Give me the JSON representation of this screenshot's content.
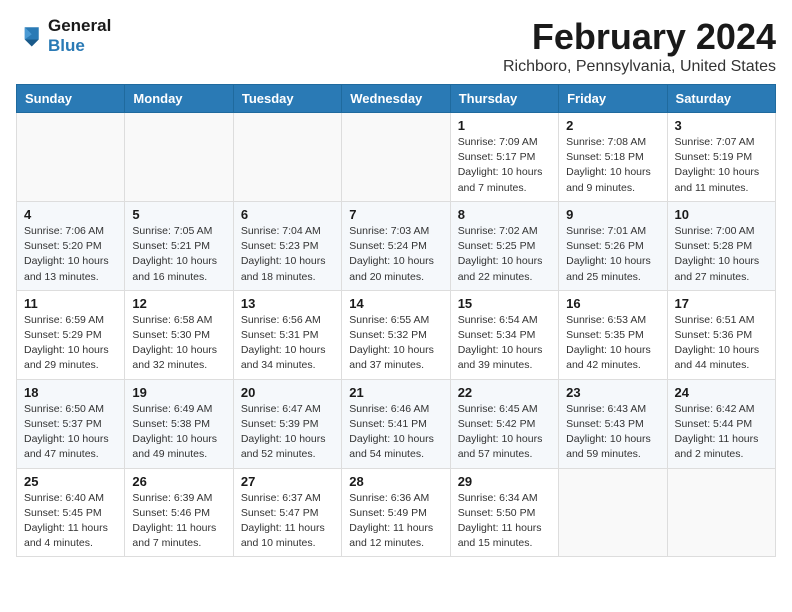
{
  "logo": {
    "line1": "General",
    "line2": "Blue"
  },
  "title": "February 2024",
  "location": "Richboro, Pennsylvania, United States",
  "days_of_week": [
    "Sunday",
    "Monday",
    "Tuesday",
    "Wednesday",
    "Thursday",
    "Friday",
    "Saturday"
  ],
  "weeks": [
    [
      {
        "day": "",
        "info": ""
      },
      {
        "day": "",
        "info": ""
      },
      {
        "day": "",
        "info": ""
      },
      {
        "day": "",
        "info": ""
      },
      {
        "day": "1",
        "info": "Sunrise: 7:09 AM\nSunset: 5:17 PM\nDaylight: 10 hours\nand 7 minutes."
      },
      {
        "day": "2",
        "info": "Sunrise: 7:08 AM\nSunset: 5:18 PM\nDaylight: 10 hours\nand 9 minutes."
      },
      {
        "day": "3",
        "info": "Sunrise: 7:07 AM\nSunset: 5:19 PM\nDaylight: 10 hours\nand 11 minutes."
      }
    ],
    [
      {
        "day": "4",
        "info": "Sunrise: 7:06 AM\nSunset: 5:20 PM\nDaylight: 10 hours\nand 13 minutes."
      },
      {
        "day": "5",
        "info": "Sunrise: 7:05 AM\nSunset: 5:21 PM\nDaylight: 10 hours\nand 16 minutes."
      },
      {
        "day": "6",
        "info": "Sunrise: 7:04 AM\nSunset: 5:23 PM\nDaylight: 10 hours\nand 18 minutes."
      },
      {
        "day": "7",
        "info": "Sunrise: 7:03 AM\nSunset: 5:24 PM\nDaylight: 10 hours\nand 20 minutes."
      },
      {
        "day": "8",
        "info": "Sunrise: 7:02 AM\nSunset: 5:25 PM\nDaylight: 10 hours\nand 22 minutes."
      },
      {
        "day": "9",
        "info": "Sunrise: 7:01 AM\nSunset: 5:26 PM\nDaylight: 10 hours\nand 25 minutes."
      },
      {
        "day": "10",
        "info": "Sunrise: 7:00 AM\nSunset: 5:28 PM\nDaylight: 10 hours\nand 27 minutes."
      }
    ],
    [
      {
        "day": "11",
        "info": "Sunrise: 6:59 AM\nSunset: 5:29 PM\nDaylight: 10 hours\nand 29 minutes."
      },
      {
        "day": "12",
        "info": "Sunrise: 6:58 AM\nSunset: 5:30 PM\nDaylight: 10 hours\nand 32 minutes."
      },
      {
        "day": "13",
        "info": "Sunrise: 6:56 AM\nSunset: 5:31 PM\nDaylight: 10 hours\nand 34 minutes."
      },
      {
        "day": "14",
        "info": "Sunrise: 6:55 AM\nSunset: 5:32 PM\nDaylight: 10 hours\nand 37 minutes."
      },
      {
        "day": "15",
        "info": "Sunrise: 6:54 AM\nSunset: 5:34 PM\nDaylight: 10 hours\nand 39 minutes."
      },
      {
        "day": "16",
        "info": "Sunrise: 6:53 AM\nSunset: 5:35 PM\nDaylight: 10 hours\nand 42 minutes."
      },
      {
        "day": "17",
        "info": "Sunrise: 6:51 AM\nSunset: 5:36 PM\nDaylight: 10 hours\nand 44 minutes."
      }
    ],
    [
      {
        "day": "18",
        "info": "Sunrise: 6:50 AM\nSunset: 5:37 PM\nDaylight: 10 hours\nand 47 minutes."
      },
      {
        "day": "19",
        "info": "Sunrise: 6:49 AM\nSunset: 5:38 PM\nDaylight: 10 hours\nand 49 minutes."
      },
      {
        "day": "20",
        "info": "Sunrise: 6:47 AM\nSunset: 5:39 PM\nDaylight: 10 hours\nand 52 minutes."
      },
      {
        "day": "21",
        "info": "Sunrise: 6:46 AM\nSunset: 5:41 PM\nDaylight: 10 hours\nand 54 minutes."
      },
      {
        "day": "22",
        "info": "Sunrise: 6:45 AM\nSunset: 5:42 PM\nDaylight: 10 hours\nand 57 minutes."
      },
      {
        "day": "23",
        "info": "Sunrise: 6:43 AM\nSunset: 5:43 PM\nDaylight: 10 hours\nand 59 minutes."
      },
      {
        "day": "24",
        "info": "Sunrise: 6:42 AM\nSunset: 5:44 PM\nDaylight: 11 hours\nand 2 minutes."
      }
    ],
    [
      {
        "day": "25",
        "info": "Sunrise: 6:40 AM\nSunset: 5:45 PM\nDaylight: 11 hours\nand 4 minutes."
      },
      {
        "day": "26",
        "info": "Sunrise: 6:39 AM\nSunset: 5:46 PM\nDaylight: 11 hours\nand 7 minutes."
      },
      {
        "day": "27",
        "info": "Sunrise: 6:37 AM\nSunset: 5:47 PM\nDaylight: 11 hours\nand 10 minutes."
      },
      {
        "day": "28",
        "info": "Sunrise: 6:36 AM\nSunset: 5:49 PM\nDaylight: 11 hours\nand 12 minutes."
      },
      {
        "day": "29",
        "info": "Sunrise: 6:34 AM\nSunset: 5:50 PM\nDaylight: 11 hours\nand 15 minutes."
      },
      {
        "day": "",
        "info": ""
      },
      {
        "day": "",
        "info": ""
      }
    ]
  ]
}
